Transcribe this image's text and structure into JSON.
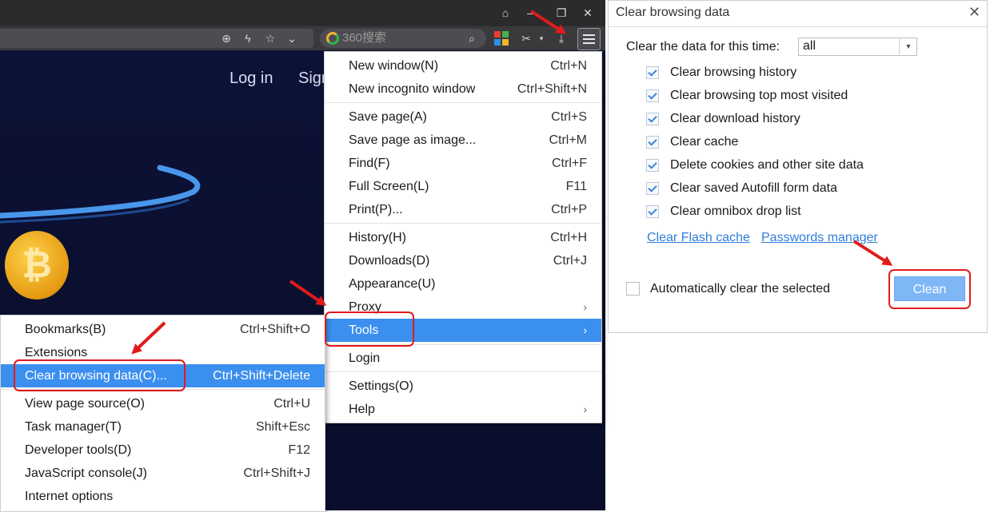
{
  "browser": {
    "search_placeholder": "360搜索",
    "page_nav": {
      "login": "Log in",
      "signup_partial": "Sign"
    }
  },
  "main_menu": {
    "items": [
      {
        "label": "New window(N)",
        "shortcut": "Ctrl+N"
      },
      {
        "label": "New incognito window",
        "shortcut": "Ctrl+Shift+N"
      },
      {
        "label": "Save page(A)",
        "shortcut": "Ctrl+S"
      },
      {
        "label": "Save page as image...",
        "shortcut": "Ctrl+M"
      },
      {
        "label": "Find(F)",
        "shortcut": "Ctrl+F"
      },
      {
        "label": "Full Screen(L)",
        "shortcut": "F11"
      },
      {
        "label": "Print(P)...",
        "shortcut": "Ctrl+P"
      },
      {
        "label": "History(H)",
        "shortcut": "Ctrl+H"
      },
      {
        "label": "Downloads(D)",
        "shortcut": "Ctrl+J"
      },
      {
        "label": "Appearance(U)",
        "shortcut": ""
      },
      {
        "label": "Proxy",
        "shortcut": ""
      },
      {
        "label": "Tools",
        "shortcut": ""
      },
      {
        "label": "Login",
        "shortcut": ""
      },
      {
        "label": "Settings(O)",
        "shortcut": ""
      },
      {
        "label": "Help",
        "shortcut": ""
      }
    ]
  },
  "tools_menu": {
    "items": [
      {
        "label": "Bookmarks(B)",
        "shortcut": "Ctrl+Shift+O"
      },
      {
        "label": "Extensions",
        "shortcut": ""
      },
      {
        "label": "Clear browsing data(C)...",
        "shortcut": "Ctrl+Shift+Delete"
      },
      {
        "label": "View page source(O)",
        "shortcut": "Ctrl+U"
      },
      {
        "label": "Task manager(T)",
        "shortcut": "Shift+Esc"
      },
      {
        "label": "Developer tools(D)",
        "shortcut": "F12"
      },
      {
        "label": "JavaScript console(J)",
        "shortcut": "Ctrl+Shift+J"
      },
      {
        "label": "Internet options",
        "shortcut": ""
      }
    ]
  },
  "dialog": {
    "title": "Clear browsing data",
    "period_label": "Clear the data for this time:",
    "period_value": "all",
    "options": [
      "Clear browsing history",
      "Clear browsing top most visited",
      "Clear download history",
      "Clear cache",
      "Delete cookies and other site data",
      "Clear saved Autofill form data",
      "Clear omnibox drop list"
    ],
    "links": {
      "flash": "Clear Flash cache",
      "passwords": "Passwords manager"
    },
    "auto_clear_label": "Automatically clear the selected",
    "clean_button": "Clean"
  },
  "colors": {
    "menu_highlight": "#3b8fef",
    "annotation_red": "#e01b1b",
    "link_blue": "#2f7ed8",
    "clean_button": "#7eb6f6"
  }
}
